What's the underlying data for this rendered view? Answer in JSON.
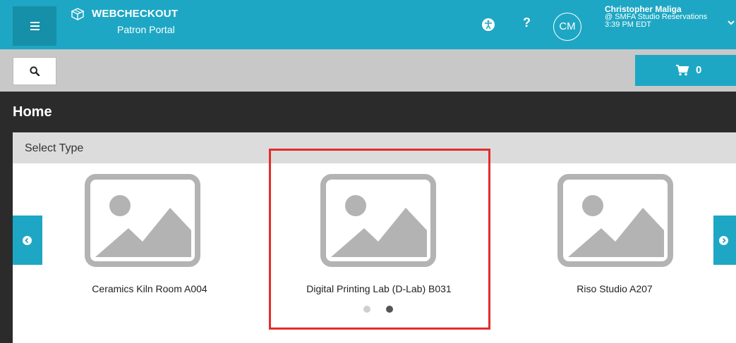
{
  "header": {
    "brand_name": "WEBCHECKOUT",
    "brand_subtitle": "Patron Portal",
    "help_label": "?",
    "user": {
      "initials": "CM",
      "name": "Christopher Maliga",
      "location": "@ SMFA Studio Reservations",
      "time": "3:39 PM EDT"
    }
  },
  "toolbar": {
    "cart_count": "0"
  },
  "page": {
    "title": "Home"
  },
  "panel": {
    "header": "Select Type",
    "items": [
      {
        "label": "Ceramics Kiln Room A004",
        "icon": "image-placeholder-icon"
      },
      {
        "label": "Digital Printing Lab (D-Lab) B031",
        "icon": "image-placeholder-icon"
      },
      {
        "label": "Riso Studio A207",
        "icon": "image-placeholder-icon"
      }
    ],
    "pagination": {
      "total": 2,
      "active": 2
    }
  },
  "colors": {
    "brand": "#1ea7c4",
    "highlight": "#e52b2b",
    "placeholder": "#b3b3b3"
  }
}
